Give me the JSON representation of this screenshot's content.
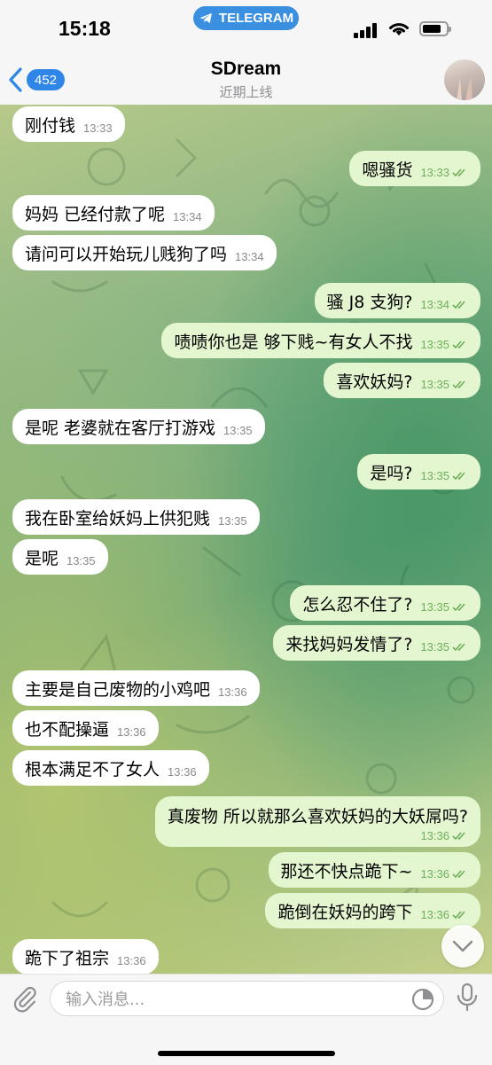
{
  "status_bar": {
    "time": "15:18",
    "app_pill": "TELEGRAM"
  },
  "header": {
    "back_count": "452",
    "name": "SDream",
    "status": "近期上线"
  },
  "messages": [
    {
      "dir": "in",
      "text": "刚付钱",
      "time": "13:33"
    },
    {
      "dir": "out",
      "text": "嗯骚货",
      "time": "13:33"
    },
    {
      "dir": "in",
      "text": "妈妈 已经付款了呢",
      "time": "13:34"
    },
    {
      "dir": "in",
      "text": "请问可以开始玩儿贱狗了吗",
      "time": "13:34"
    },
    {
      "dir": "out",
      "text": "骚 J8 支狗?",
      "time": "13:34"
    },
    {
      "dir": "out",
      "text": "啧啧你也是 够下贱~有女人不找",
      "time": "13:35"
    },
    {
      "dir": "out",
      "text": "喜欢妖妈?",
      "time": "13:35"
    },
    {
      "dir": "in",
      "text": "是呢 老婆就在客厅打游戏",
      "time": "13:35"
    },
    {
      "dir": "out",
      "text": "是吗?",
      "time": "13:35"
    },
    {
      "dir": "in",
      "text": "我在卧室给妖妈上供犯贱",
      "time": "13:35"
    },
    {
      "dir": "in",
      "text": "是呢",
      "time": "13:35"
    },
    {
      "dir": "out",
      "text": "怎么忍不住了?",
      "time": "13:35"
    },
    {
      "dir": "out",
      "text": "来找妈妈发情了?",
      "time": "13:35"
    },
    {
      "dir": "in",
      "text": "主要是自己废物的小鸡吧",
      "time": "13:36"
    },
    {
      "dir": "in",
      "text": "也不配操逼",
      "time": "13:36"
    },
    {
      "dir": "in",
      "text": "根本满足不了女人",
      "time": "13:36"
    },
    {
      "dir": "out",
      "text": "真废物 所以就那么喜欢妖妈的大妖屌吗?",
      "time": "13:36"
    },
    {
      "dir": "out",
      "text": "那还不快点跪下~",
      "time": "13:36"
    },
    {
      "dir": "out",
      "text": "跪倒在妖妈的跨下",
      "time": "13:36"
    },
    {
      "dir": "in",
      "text": "跪下了祖宗",
      "time": "13:36"
    }
  ],
  "composer": {
    "placeholder": "输入消息..."
  },
  "colors": {
    "incoming_bubble": "#ffffff",
    "outgoing_bubble": "#e4f6cf",
    "accent": "#2f86e6"
  }
}
